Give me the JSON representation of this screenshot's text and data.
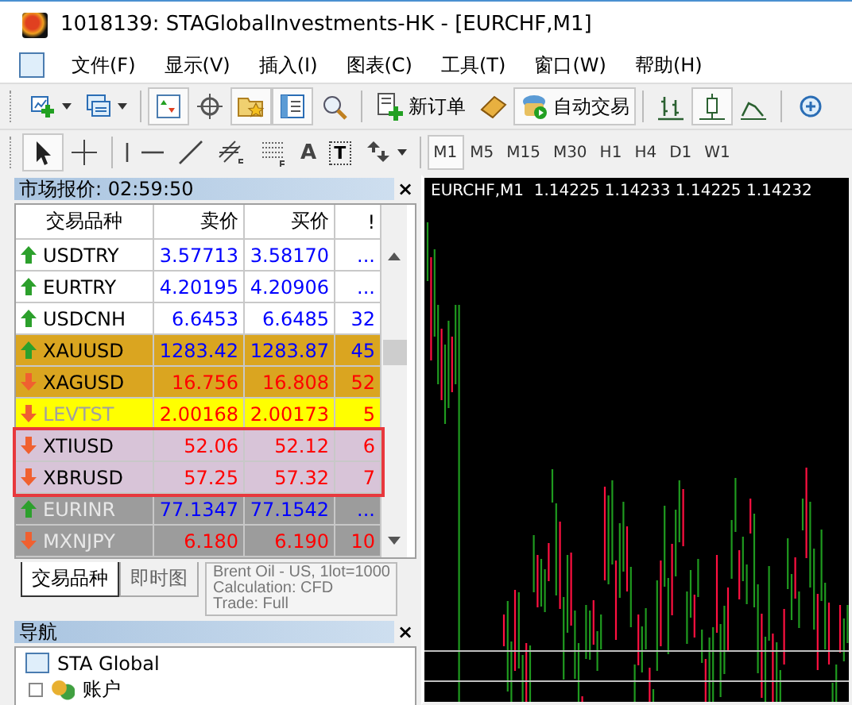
{
  "window": {
    "title": "1018139: STAGlobalInvestments-HK - [EURCHF,M1]"
  },
  "menu": [
    "文件(F)",
    "显示(V)",
    "插入(I)",
    "图表(C)",
    "工具(T)",
    "窗口(W)",
    "帮助(H)"
  ],
  "toolbar_main": [
    {
      "kind": "new-chart",
      "pressed": false,
      "dropdown": true
    },
    {
      "kind": "profiles",
      "pressed": false,
      "dropdown": true
    },
    {
      "kind": "separator"
    },
    {
      "kind": "market-watch",
      "pressed": true
    },
    {
      "kind": "crosshair",
      "pressed": false
    },
    {
      "kind": "navigator",
      "pressed": true
    },
    {
      "kind": "terminal",
      "pressed": true
    },
    {
      "kind": "tester",
      "pressed": false
    },
    {
      "kind": "separator"
    },
    {
      "kind": "new-order",
      "label": "新订单",
      "pressed": false
    },
    {
      "kind": "editor",
      "pressed": false
    },
    {
      "kind": "autotrading",
      "label": "自动交易",
      "pressed": true
    },
    {
      "kind": "separator"
    },
    {
      "kind": "bars",
      "pressed": false
    },
    {
      "kind": "candles",
      "pressed": true
    },
    {
      "kind": "line",
      "pressed": false
    },
    {
      "kind": "separator"
    },
    {
      "kind": "zoom",
      "pressed": false
    }
  ],
  "toolbar_tools": [
    {
      "kind": "cursor",
      "pressed": true
    },
    {
      "kind": "cross",
      "pressed": false
    },
    {
      "kind": "separator"
    },
    {
      "kind": "vline",
      "pressed": false
    },
    {
      "kind": "hline",
      "pressed": false
    },
    {
      "kind": "trend",
      "pressed": false
    },
    {
      "kind": "channel",
      "pressed": false
    },
    {
      "kind": "fibo",
      "pressed": false
    },
    {
      "kind": "text",
      "label": "A",
      "pressed": false
    },
    {
      "kind": "label",
      "label": "T",
      "pressed": false
    },
    {
      "kind": "arrows",
      "pressed": false,
      "dropdown": true
    },
    {
      "kind": "separator"
    }
  ],
  "timeframes": [
    {
      "label": "M1",
      "selected": true
    },
    {
      "label": "M5",
      "selected": false
    },
    {
      "label": "M15",
      "selected": false
    },
    {
      "label": "M30",
      "selected": false
    },
    {
      "label": "H1",
      "selected": false
    },
    {
      "label": "H4",
      "selected": false
    },
    {
      "label": "D1",
      "selected": false
    },
    {
      "label": "W1",
      "selected": false
    }
  ],
  "market_watch": {
    "title": "市场报价: 02:59:50",
    "close": "×",
    "columns": [
      "交易品种",
      "卖价",
      "买价",
      "!"
    ],
    "rows": [
      {
        "symbol": "USDTRY",
        "bid": "3.57713",
        "ask": "3.58170",
        "spread": "...",
        "rising": true,
        "color": "#ffffff",
        "greyed": false,
        "highlighted": false
      },
      {
        "symbol": "EURTRY",
        "bid": "4.20195",
        "ask": "4.20906",
        "spread": "...",
        "rising": true,
        "color": "#ffffff",
        "greyed": false,
        "highlighted": false
      },
      {
        "symbol": "USDCNH",
        "bid": "6.6453",
        "ask": "6.6485",
        "spread": "32",
        "rising": true,
        "color": "#ffffff",
        "greyed": false,
        "highlighted": false
      },
      {
        "symbol": "XAUUSD",
        "bid": "1283.42",
        "ask": "1283.87",
        "spread": "45",
        "rising": true,
        "color": "#daa520",
        "greyed": false,
        "highlighted": false
      },
      {
        "symbol": "XAGUSD",
        "bid": "16.756",
        "ask": "16.808",
        "spread": "52",
        "rising": false,
        "color": "#daa520",
        "greyed": false,
        "highlighted": false
      },
      {
        "symbol": "LEVTST",
        "bid": "2.00168",
        "ask": "2.00173",
        "spread": "5",
        "rising": false,
        "color": "#ffff00",
        "greyed": true,
        "highlighted": false
      },
      {
        "symbol": "XTIUSD",
        "bid": "52.06",
        "ask": "52.12",
        "spread": "6",
        "rising": false,
        "color": "#d8c4d8",
        "greyed": false,
        "highlighted": true
      },
      {
        "symbol": "XBRUSD",
        "bid": "57.25",
        "ask": "57.32",
        "spread": "7",
        "rising": false,
        "color": "#d8c4d8",
        "greyed": false,
        "highlighted": true
      },
      {
        "symbol": "EURINR",
        "bid": "77.1347",
        "ask": "77.1542",
        "spread": "...",
        "rising": true,
        "color": "#9c9c9c",
        "greyed": true,
        "highlighted": false
      },
      {
        "symbol": "MXNJPY",
        "bid": "6.180",
        "ask": "6.190",
        "spread": "10",
        "rising": false,
        "color": "#9c9c9c",
        "greyed": true,
        "highlighted": false
      }
    ],
    "tooltip": [
      "Brent Oil - US, 1lot=1000",
      "Calculation: CFD",
      "Trade: Full"
    ],
    "tabs": [
      {
        "label": "交易品种",
        "selected": true
      },
      {
        "label": "即时图",
        "selected": false
      }
    ]
  },
  "navigator": {
    "title": "导航",
    "close": "×",
    "tree": [
      {
        "label": "STA Global",
        "kind": "terminal",
        "children": [
          {
            "label": "账户",
            "kind": "accounts"
          }
        ]
      }
    ]
  },
  "chart": {
    "caption": "EURCHF,M1  1.14225 1.14233 1.14225 1.14232"
  }
}
